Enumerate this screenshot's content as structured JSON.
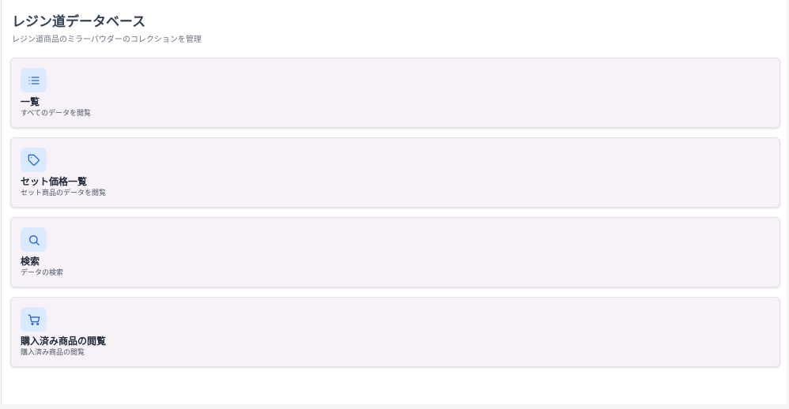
{
  "header": {
    "title": "レジン道データベース",
    "subtitle": "レジン道商品のミラーパウダーのコレクションを管理"
  },
  "menu": [
    {
      "icon": "list-icon",
      "title": "一覧",
      "description": "すべてのデータを閲覧"
    },
    {
      "icon": "tag-icon",
      "title": "セット価格一覧",
      "description": "セット商品のデータを閲覧"
    },
    {
      "icon": "search-icon",
      "title": "検索",
      "description": "データの検索"
    },
    {
      "icon": "cart-icon",
      "title": "購入済み商品の閲覧",
      "description": "購入済み商品の閲覧"
    }
  ],
  "colors": {
    "accent": "#2563eb",
    "icon_bg": "#dbeafe",
    "card_bg": "#f7f2f8"
  }
}
